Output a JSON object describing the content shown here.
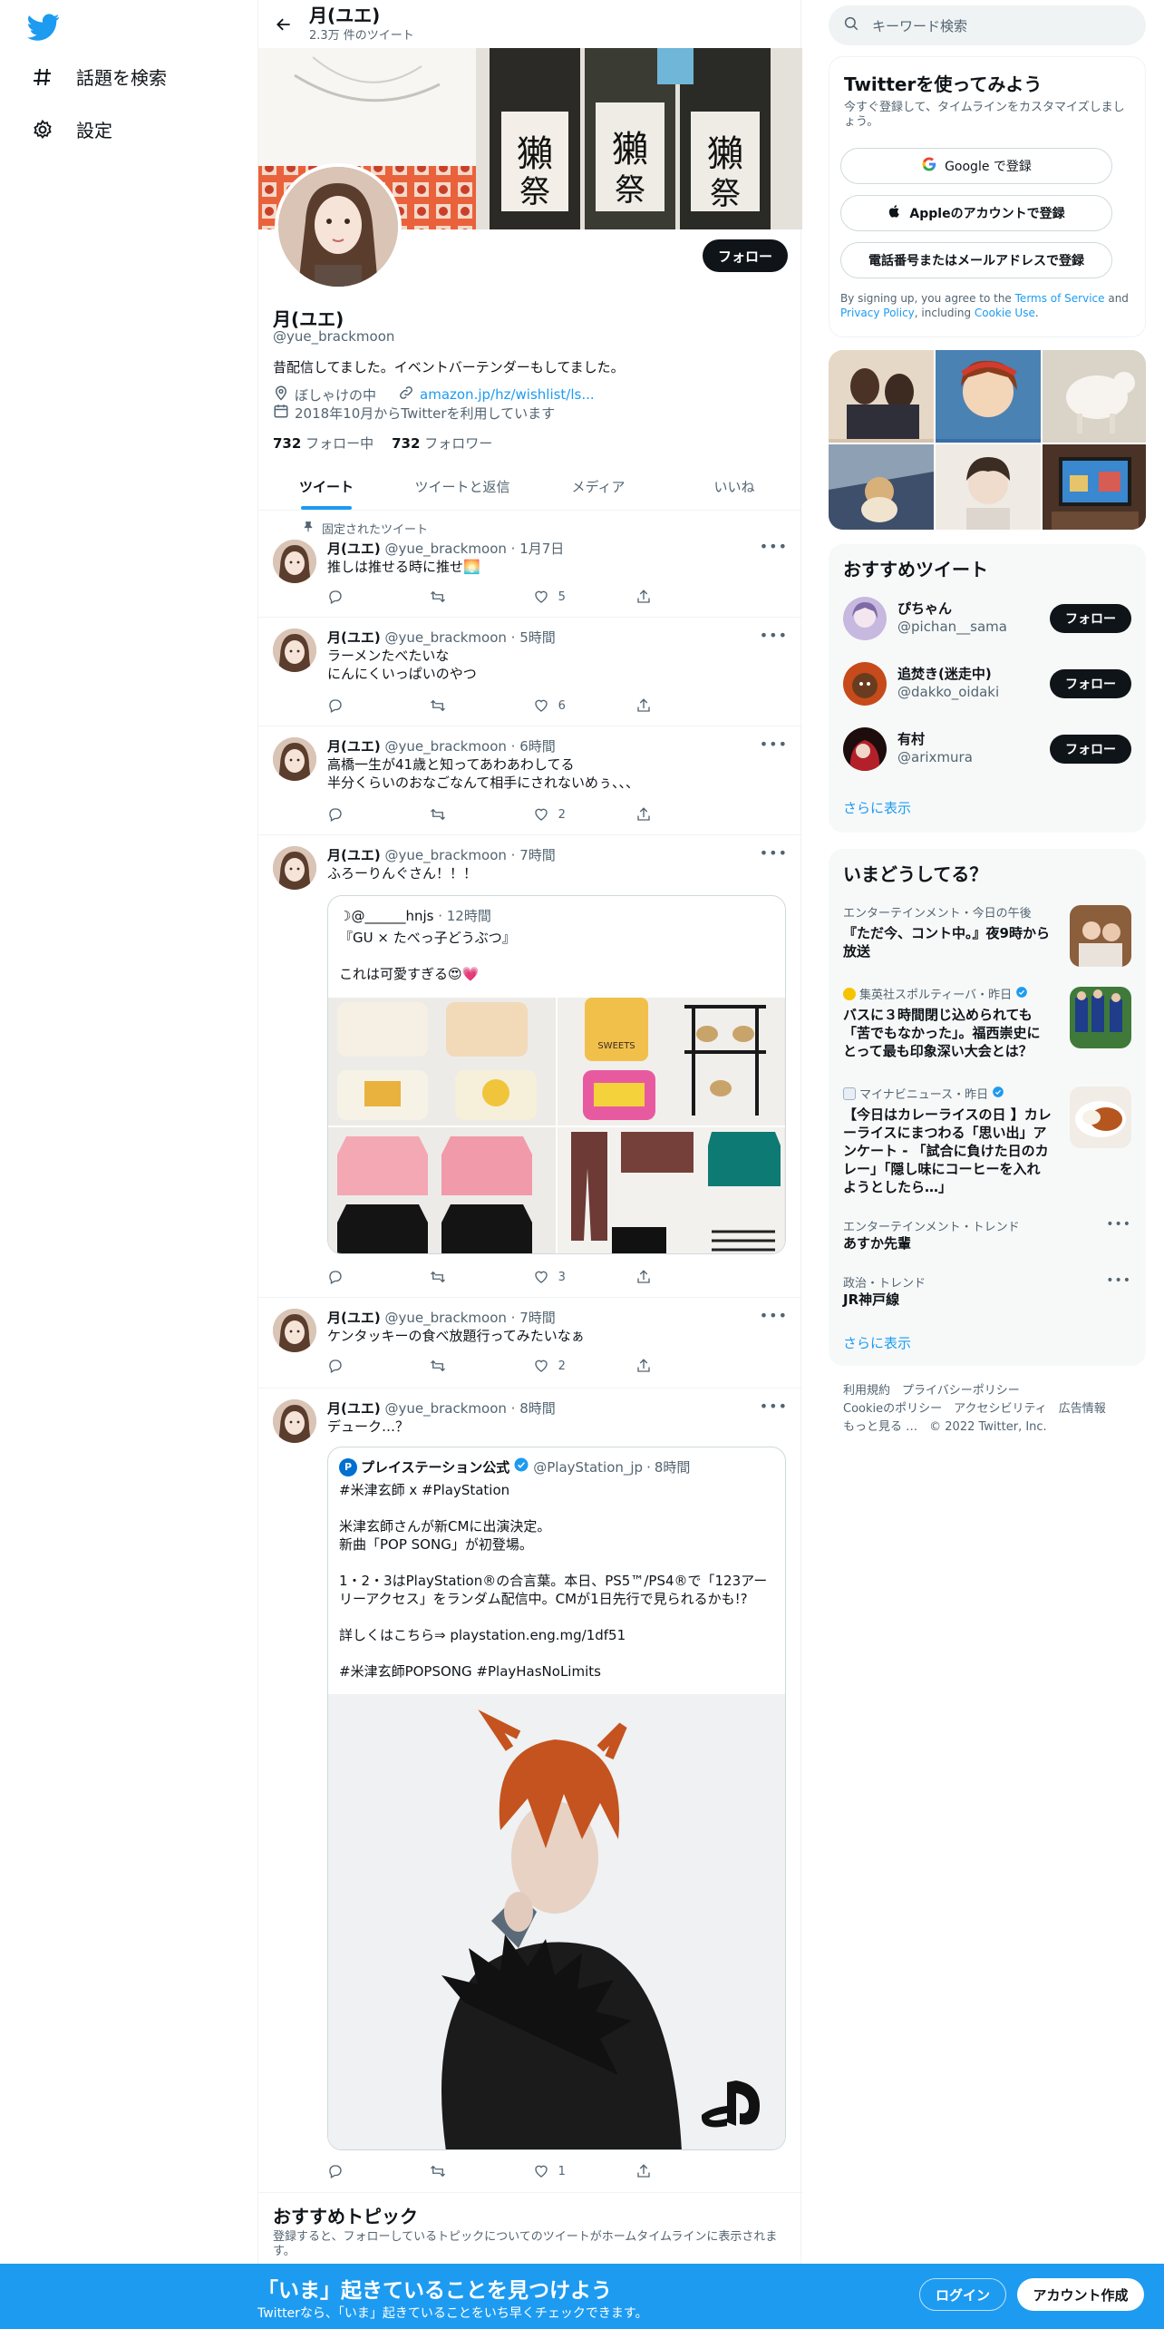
{
  "nav": {
    "explore_label": "話題を検索",
    "settings_label": "設定"
  },
  "header": {
    "title": "月(ユエ)",
    "subtitle": "2.3万 件のツイート"
  },
  "profile": {
    "follow_button": "フォロー",
    "name": "月(ユエ)",
    "handle": "@yue_brackmoon",
    "bio": "昔配信してました。イベントバーテンダーもしてました。",
    "location": "ぼしゃけの中",
    "link": "amazon.jp/hz/wishlist/ls...",
    "joined": "2018年10月からTwitterを利用しています",
    "following_count": "732",
    "following_label": "フォロー中",
    "followers_count": "732",
    "followers_label": "フォロワー"
  },
  "tabs": [
    "ツイート",
    "ツイートと返信",
    "メディア",
    "いいね"
  ],
  "tweets": [
    {
      "pinned": "固定されたツイート",
      "name": "月(ユエ)",
      "handle": "@yue_brackmoon",
      "time": "1月7日",
      "text1": "推しは推せる時に推せ🌅",
      "text2": "",
      "likes": "5"
    },
    {
      "name": "月(ユエ)",
      "handle": "@yue_brackmoon",
      "time": "5時間",
      "text1": "ラーメンたべたいな",
      "text2": "にんにくいっぱいのやつ",
      "likes": "6"
    },
    {
      "name": "月(ユエ)",
      "handle": "@yue_brackmoon",
      "time": "6時間",
      "text1": "高橋一生が41歳と知ってあわあわしてる",
      "text2": "半分くらいのおなごなんて相手にされないめぅ、、、",
      "likes": "2"
    },
    {
      "name": "月(ユエ)",
      "handle": "@yue_brackmoon",
      "time": "7時間",
      "text1": "ふろーりんぐさん！！！",
      "text2": "",
      "likes": "3",
      "quote": {
        "author": "☽@______hnjs",
        "time": "12時間",
        "line1": "『GU × たべっ子どうぶつ』",
        "line2": "これは可愛すぎる😍💗"
      }
    },
    {
      "name": "月(ユエ)",
      "handle": "@yue_brackmoon",
      "time": "7時間",
      "text1": "ケンタッキーの食べ放題行ってみたいなぁ",
      "text2": "",
      "likes": "2"
    },
    {
      "name": "月(ユエ)",
      "handle": "@yue_brackmoon",
      "time": "8時間",
      "text1": "デューク…？",
      "text2": "",
      "likes": "1",
      "quote": {
        "author": "プレイステーション公式",
        "handle": "@PlayStation_jp",
        "time": "8時間",
        "l1": "#米津玄師 x #PlayStation",
        "l2": "米津玄師さんが新CMに出演決定。",
        "l3": "新曲「POP SONG」が初登場。",
        "l4": "1・2・3はPlayStation®の合言葉。本日、PS5™/PS4®で「123アーリーアクセス」をランダム配信中。CMが1日先行で見られるかも!?",
        "l5": "詳しくはこちら⇒ playstation.eng.mg/1df51",
        "l6": "#米津玄師POPSONG #PlayHasNoLimits"
      }
    }
  ],
  "topics": {
    "title": "おすすめトピック",
    "desc": "登録すると、フォローしているトピックについてのツイートがホームタイムラインに表示されます。"
  },
  "search": {
    "placeholder": "キーワード検索"
  },
  "signup": {
    "title": "Twitterを使ってみよう",
    "desc": "今すぐ登録して、タイムラインをカスタマイズしましょう。",
    "google": "Google で登録",
    "apple": "Appleのアカウントで登録",
    "phone": "電話番号またはメールアドレスで登録",
    "terms1": "By signing up, you agree to the ",
    "terms_tos": "Terms of Service",
    "terms2": " and ",
    "terms_pp": "Privacy Policy",
    "terms3": ", including ",
    "terms_cookie": "Cookie Use",
    "terms4": "."
  },
  "who_to_follow": {
    "title": "おすすめツイート",
    "users": [
      {
        "name": "ぴちゃん",
        "handle": "@pichan__sama"
      },
      {
        "name": "追焚き(迷走中)",
        "handle": "@dakko_oidaki"
      },
      {
        "name": "有村",
        "handle": "@arixmura"
      }
    ],
    "follow_label": "フォロー",
    "more": "さらに表示"
  },
  "trends": {
    "title": "いまどうしてる？",
    "items": [
      {
        "cat": "エンターテインメント・今日の午後",
        "title": "『ただ今、コント中。』夜9時から放送"
      },
      {
        "cat": "集英社スポルティーバ・昨日",
        "title": "バスに３時間閉じ込められても「苦でもなかった」。福西崇史にとって最も印象深い大会とは？"
      },
      {
        "cat": "マイナビニュース・昨日",
        "title": "【今日はカレーライスの日 】カレーライスにまつわる「思い出」アンケート - 「試合に負けた日のカレー」「隠し味にコーヒーを入れようとしたら…」"
      },
      {
        "cat": "エンターテインメント・トレンド",
        "title": "あすか先輩"
      },
      {
        "cat": "政治・トレンド",
        "title": "JR神戸線"
      }
    ],
    "more": "さらに表示"
  },
  "footer": {
    "l1": "利用規約",
    "l2": "プライバシーポリシー",
    "l3": "Cookieのポリシー",
    "l4": "アクセシビリティ",
    "l5": "広告情報",
    "l6": "もっと見る …",
    "l7": "© 2022 Twitter, Inc."
  },
  "bottom": {
    "title": "「いま」起きていることを見つけよう",
    "sub": "Twitterなら、「いま」起きていることをいち早くチェックできます。",
    "login": "ログイン",
    "signup": "アカウント作成"
  },
  "colors": {
    "accent": "#1d9bf0",
    "text": "#0f1419",
    "muted": "#536471"
  }
}
